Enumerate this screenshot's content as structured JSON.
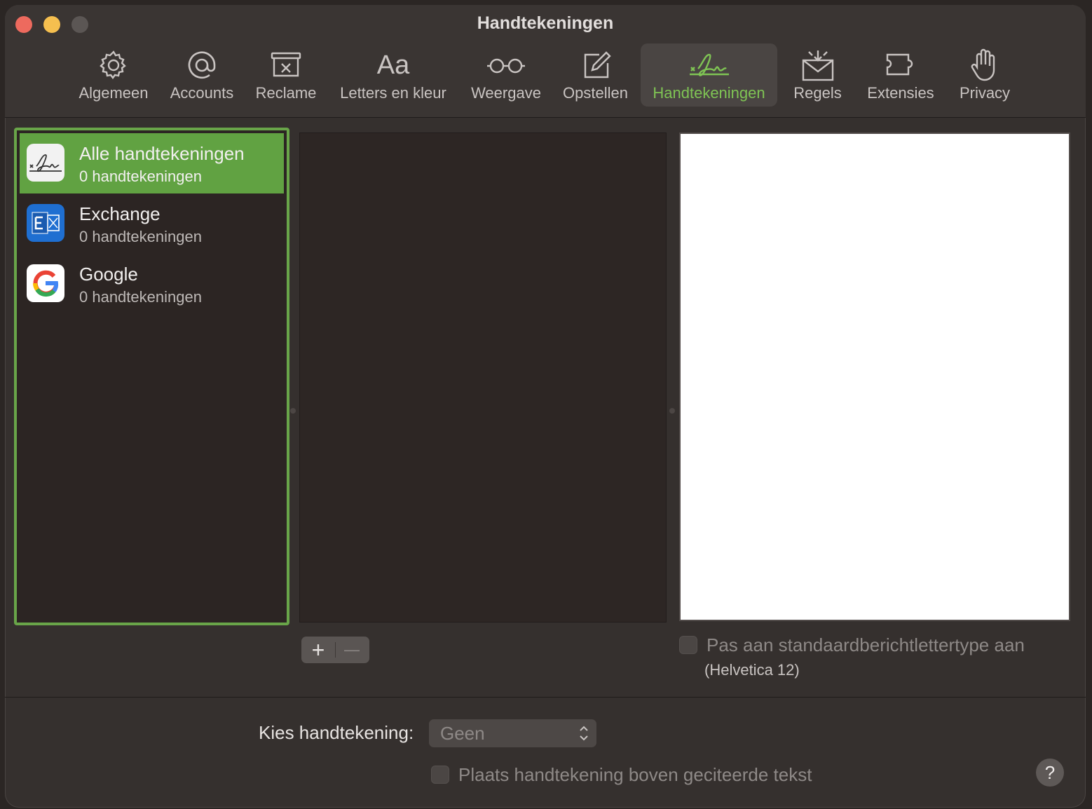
{
  "window": {
    "title": "Handtekeningen"
  },
  "tabs": [
    {
      "label": "Algemeen",
      "icon": "gear-icon"
    },
    {
      "label": "Accounts",
      "icon": "at-sign-icon"
    },
    {
      "label": "Reclame",
      "icon": "junk-box-icon"
    },
    {
      "label": "Letters en kleur",
      "icon": "font-aa-icon",
      "glyph": "Aa"
    },
    {
      "label": "Weergave",
      "icon": "glasses-icon"
    },
    {
      "label": "Opstellen",
      "icon": "compose-icon"
    },
    {
      "label": "Handtekeningen",
      "icon": "signature-icon",
      "active": true
    },
    {
      "label": "Regels",
      "icon": "rules-envelope-icon"
    },
    {
      "label": "Extensies",
      "icon": "puzzle-icon"
    },
    {
      "label": "Privacy",
      "icon": "hand-icon"
    }
  ],
  "accounts": [
    {
      "name": "Alle handtekeningen",
      "count": "0 handtekeningen",
      "icon": "signature-icon",
      "selected": true
    },
    {
      "name": "Exchange",
      "count": "0 handtekeningen",
      "icon": "exchange-icon"
    },
    {
      "name": "Google",
      "count": "0 handtekeningen",
      "icon": "google-icon"
    }
  ],
  "editor": {
    "add_label": "+",
    "remove_label": "—",
    "font_checkbox_label": "Pas aan standaardberichtlettertype aan",
    "font_checkbox_sub": "(Helvetica 12)"
  },
  "footer": {
    "choose_label": "Kies handtekening:",
    "choose_value": "Geen",
    "place_above_label": "Plaats handtekening boven geciteerde tekst",
    "help_label": "?"
  },
  "colors": {
    "accent_green": "#61a242",
    "tab_active_text": "#7fc454"
  }
}
